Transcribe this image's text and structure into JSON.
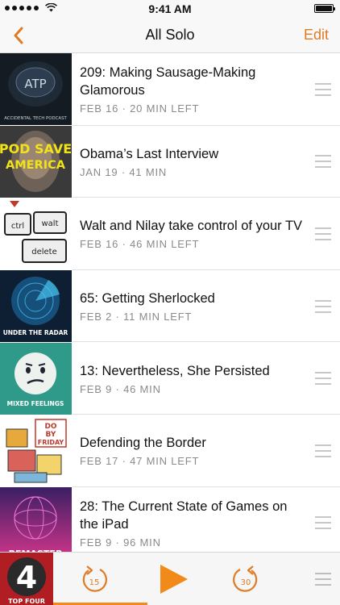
{
  "status_bar": {
    "time": "9:41 AM",
    "signal_dots": 5
  },
  "nav": {
    "title": "All Solo",
    "edit_label": "Edit"
  },
  "theme": {
    "accent": "#E07B24",
    "meta_color": "#8A8A8A",
    "separator": "#E0E0E0"
  },
  "episodes": [
    {
      "title": "209: Making Sausage-Making Glamorous",
      "meta": "FEB 16 · 20 MIN LEFT",
      "artwork": "atp-artwork",
      "artwork_text": [
        "ATP",
        "ACCIDENTAL TECH PODCAST"
      ]
    },
    {
      "title": "Obama’s Last Interview",
      "meta": "JAN 19 · 41 MIN",
      "artwork": "pod-save-america-artwork",
      "artwork_text": [
        "POD SAVE",
        "AMERICA"
      ]
    },
    {
      "title": "Walt and Nilay take control of your TV",
      "meta": "FEB 16 · 46 MIN LEFT",
      "artwork": "ctrl-walt-delete-artwork",
      "artwork_text": [
        "ctrl",
        "walt",
        "delete"
      ]
    },
    {
      "title": "65: Getting Sherlocked",
      "meta": "FEB 2 · 11 MIN LEFT",
      "artwork": "under-the-radar-artwork",
      "artwork_text": [
        "UNDER THE RADAR"
      ]
    },
    {
      "title": "13: Nevertheless, She Persisted",
      "meta": "FEB 9 · 46 MIN",
      "artwork": "mixed-feelings-artwork",
      "artwork_text": [
        "MIXED FEELINGS"
      ]
    },
    {
      "title": "Defending the Border",
      "meta": "FEB 17 · 47 MIN LEFT",
      "artwork": "do-by-friday-artwork",
      "artwork_text": [
        "DO",
        "BY",
        "FRIDAY"
      ]
    },
    {
      "title": "28: The Current State of Games on the iPad",
      "meta": "FEB 9 · 96 MIN",
      "artwork": "remaster-artwork",
      "artwork_text": [
        "REMASTER"
      ]
    }
  ],
  "player": {
    "artwork": "top-four-artwork",
    "artwork_text": "TOP FOUR",
    "skip_back_seconds": "15",
    "skip_forward_seconds": "30",
    "progress_fraction": 0.33
  }
}
